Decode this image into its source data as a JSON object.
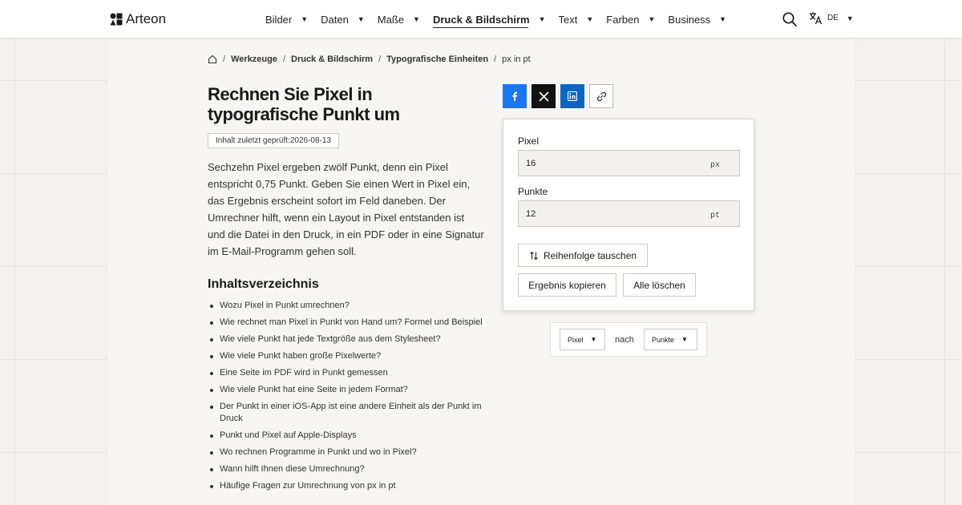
{
  "brand": {
    "name": "Arteon"
  },
  "nav": {
    "items": [
      {
        "label": "Bilder",
        "active": false
      },
      {
        "label": "Daten",
        "active": false
      },
      {
        "label": "Maße",
        "active": false
      },
      {
        "label": "Druck & Bildschirm",
        "active": true
      },
      {
        "label": "Text",
        "active": false
      },
      {
        "label": "Farben",
        "active": false
      },
      {
        "label": "Business",
        "active": false
      }
    ],
    "language": "DE",
    "caret": "▼"
  },
  "breadcrumb": {
    "items": [
      "Werkzeuge",
      "Druck & Bildschirm",
      "Typografische Einheiten"
    ],
    "current": "px in pt",
    "separator": "/"
  },
  "page": {
    "title": "Rechnen Sie Pixel in typografische Punkt um",
    "reviewed": "Inhalt zuletzt geprüft:2026-08-13",
    "intro": "Sechzehn Pixel ergeben zwölf Punkt, denn ein Pixel entspricht 0,75 Punkt. Geben Sie einen Wert in Pixel ein, das Ergebnis erscheint sofort im Feld daneben. Der Umrechner hilft, wenn ein Layout in Pixel entstanden ist und die Datei in den Druck, in ein PDF oder in eine Signatur im E-Mail-Programm gehen soll."
  },
  "toc": {
    "title": "Inhaltsverzeichnis",
    "items": [
      "Wozu Pixel in Punkt umrechnen?",
      "Wie rechnet man Pixel in Punkt von Hand um? Formel und Beispiel",
      "Wie viele Punkt hat jede Textgröße aus dem Stylesheet?",
      "Wie viele Punkt haben große Pixelwerte?",
      "Eine Seite im PDF wird in Punkt gemessen",
      "Wie viele Punkt hat eine Seite in jedem Format?",
      "Der Punkt in einer iOS-App ist eine andere Einheit als der Punkt im Druck",
      "Punkt und Pixel auf Apple-Displays",
      "Wo rechnen Programme in Punkt und wo in Pixel?",
      "Wann hilft Ihnen diese Umrechnung?",
      "Häufige Fragen zur Umrechnung von px in pt"
    ]
  },
  "share": {
    "icons": [
      "facebook-icon",
      "x-icon",
      "linkedin-icon",
      "link-icon"
    ],
    "colors": {
      "facebook": "#1877f2",
      "x": "#111111",
      "linkedin": "#0a66c2"
    }
  },
  "converter": {
    "from": {
      "label": "Pixel",
      "value": "16",
      "unit": "px"
    },
    "to": {
      "label": "Punkte",
      "value": "12",
      "unit": "pt"
    },
    "swap_label": "Reihenfolge tauschen",
    "copy_label": "Ergebnis kopieren",
    "clear_label": "Alle löschen"
  },
  "units": {
    "from": "Pixel",
    "connector": "nach",
    "to": "Punkte"
  }
}
